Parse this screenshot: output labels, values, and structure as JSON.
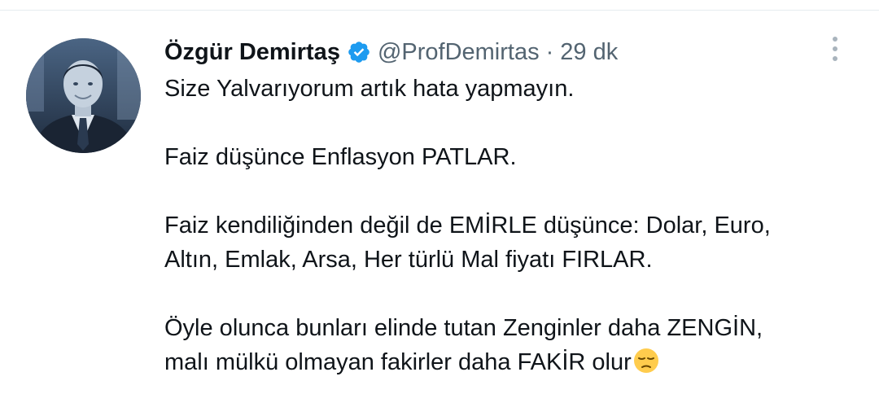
{
  "tweet": {
    "author_name": "Özgür Demirtaş",
    "handle": "@ProfDemirtas",
    "separator": "·",
    "time": "29 dk",
    "lines": [
      "Size Yalvarıyorum artık hata yapmayın.",
      "Faiz düşünce Enflasyon PATLAR.",
      "Faiz kendiliğinden değil de EMİRLE düşünce: Dolar, Euro,",
      "Altın, Emlak, Arsa, Her türlü Mal fiyatı FIRLAR.",
      "Öyle olunca bunları elinde tutan Zenginler daha ZENGİN,",
      "malı mülkü olmayan fakirler daha FAKİR olur"
    ],
    "trailing_emoji": "pensive-face-icon"
  },
  "colors": {
    "text": "#0f1419",
    "secondary": "#536471",
    "verified": "#1d9bf0",
    "avatar_tint": "#2d3f57"
  },
  "icons": {
    "verified": "verified-badge-icon",
    "more": "more-options-icon"
  }
}
